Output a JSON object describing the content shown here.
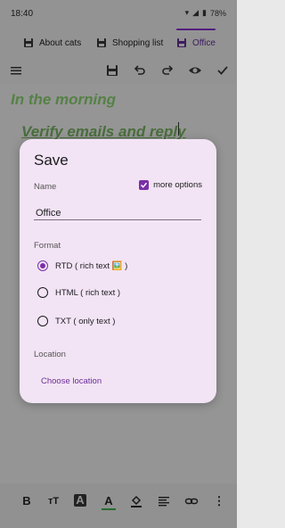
{
  "status_bar": {
    "time": "18:40",
    "battery": "78%"
  },
  "tabs": [
    {
      "label": "About cats"
    },
    {
      "label": "Shopping list"
    },
    {
      "label": "Office",
      "active": true
    }
  ],
  "editor": {
    "heading1": "In the morning",
    "heading2": "Verify emails and reply"
  },
  "dialog": {
    "title": "Save",
    "name_label": "Name",
    "more_options_label": "more options",
    "more_options_checked": true,
    "name_value": "Office",
    "format_label": "Format",
    "formats": [
      {
        "label": "RTD ( rich text 🖼️ )",
        "selected": true
      },
      {
        "label": "HTML ( rich text )",
        "selected": false
      },
      {
        "label": "TXT ( only text )",
        "selected": false
      }
    ],
    "location_label": "Location",
    "choose_location_label": "Choose location"
  },
  "colors": {
    "accent": "#7a2fa8",
    "heading_green": "#4caf2a"
  },
  "icons": {
    "toolbar": [
      "menu-icon",
      "save-icon",
      "undo-icon",
      "redo-icon",
      "eye-icon",
      "check-icon"
    ],
    "bottom": [
      "bold-icon",
      "text-size-icon",
      "text-color-box-icon",
      "text-color-icon",
      "fill-color-icon",
      "align-icon",
      "link-icon",
      "more-vert-icon"
    ]
  }
}
